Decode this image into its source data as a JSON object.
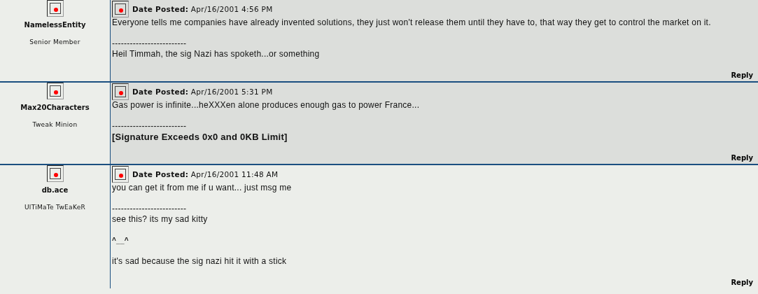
{
  "posts": [
    {
      "author": "NamelessEntity",
      "rank": "Senior Member",
      "date_label": "Date Posted:",
      "date": "Apr/16/2001 4:56 PM",
      "body": "Everyone tells me companies have already invented solutions, they just won't release them until they have to, that way they get to control the market on it.",
      "separator": "-------------------------",
      "signature": [
        {
          "kind": "plain",
          "text": "Heil Timmah, the sig Nazi has spoketh...or something"
        }
      ],
      "reply": "Reply",
      "shaded": true
    },
    {
      "author": "Max20Characters",
      "rank": "Tweak Minion",
      "date_label": "Date Posted:",
      "date": "Apr/16/2001 5:31 PM",
      "body": "Gas power is infinite...heXXXen alone produces enough gas to power France...",
      "separator": "-------------------------",
      "signature": [
        {
          "kind": "bold",
          "text": "[Signature Exceeds 0x0 and 0KB Limit]"
        }
      ],
      "reply": "Reply",
      "shaded": true
    },
    {
      "author": "db.ace",
      "rank": "UlTiMaTe TwEaKeR",
      "date_label": "Date Posted:",
      "date": "Apr/16/2001 11:48 AM",
      "body": "you can get it from me if u want... just msg me",
      "separator": "-------------------------",
      "signature": [
        {
          "kind": "plain",
          "text": "see this? its my sad kitty"
        },
        {
          "kind": "emote",
          "text": "^__^"
        },
        {
          "kind": "plain",
          "text": "it's sad because the sig nazi hit it with a stick"
        }
      ],
      "reply": "Reply",
      "shaded": false
    }
  ]
}
